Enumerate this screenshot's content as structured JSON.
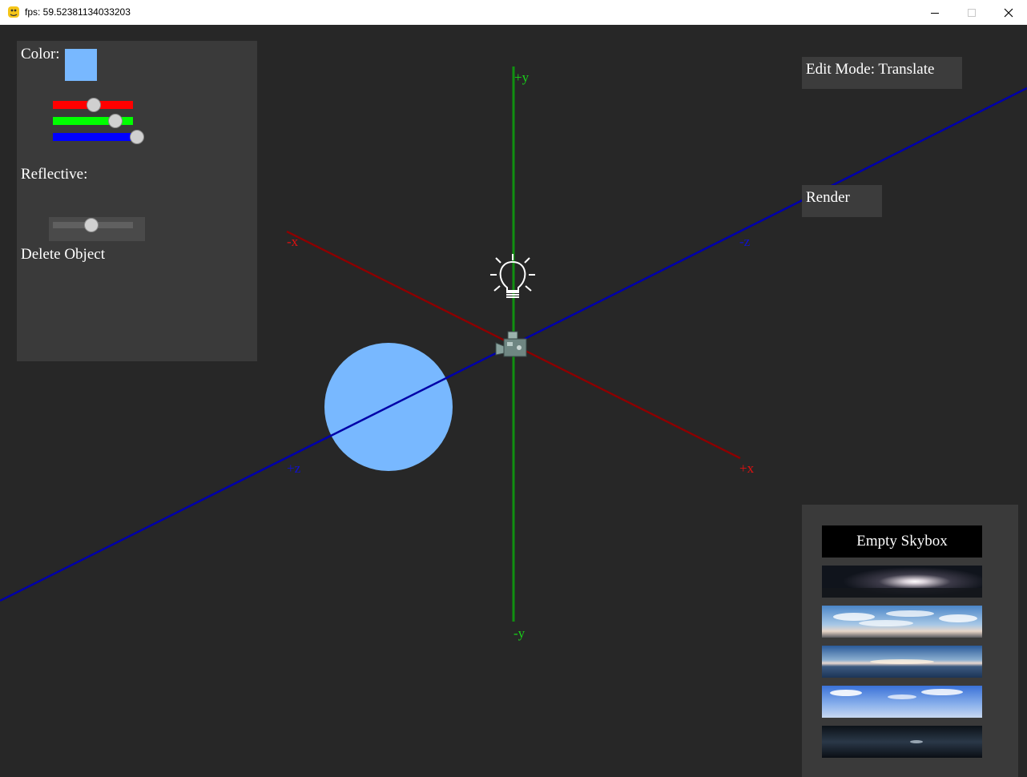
{
  "window": {
    "title": "fps: 59.52381134033203"
  },
  "colors": {
    "viewport_bg": "#272727",
    "panel_bg": "#3a3a3a",
    "object_color": "#78b8ff",
    "axis_x": "#8b0000",
    "axis_y": "#109010",
    "axis_z": "#0000a8"
  },
  "properties_panel": {
    "color_label": "Color:",
    "rgb_sliders": {
      "red": 0.51,
      "green": 0.78,
      "blue": 1.0
    },
    "reflective_label": "Reflective:",
    "reflective_value": 0.48,
    "delete_label": "Delete Object"
  },
  "edit_mode_button": "Edit Mode: Translate",
  "render_button": "Render",
  "axes": {
    "pos_y": "+y",
    "neg_y": "-y",
    "pos_x": "+x",
    "neg_x": "-x",
    "pos_z": "+z",
    "neg_z": "-z"
  },
  "scene_objects": {
    "light": "lightbulb-icon",
    "camera": "camera-icon",
    "sphere": "sphere"
  },
  "skybox_panel": {
    "empty_label": "Empty Skybox",
    "thumbnails": [
      "night-nebula",
      "cloudy-day",
      "sunset-horizon",
      "clear-sky",
      "dark-night"
    ]
  }
}
